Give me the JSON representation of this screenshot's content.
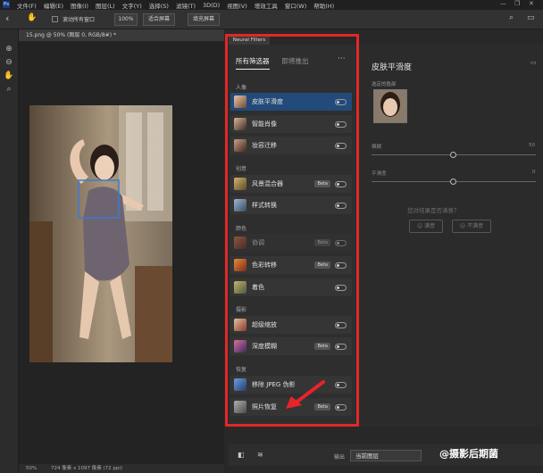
{
  "menubar": {
    "logo": "Ps",
    "items": [
      "文件(F)",
      "编辑(E)",
      "图像(I)",
      "图层(L)",
      "文字(Y)",
      "选择(S)",
      "滤镜(T)",
      "3D(D)",
      "视图(V)",
      "增效工具",
      "窗口(W)",
      "帮助(H)"
    ]
  },
  "optionsbar": {
    "scroll_all_label": "滚动所有窗口",
    "zoom_value": "100%",
    "fit_screen_label": "适合屏幕",
    "fill_screen_label": "填充屏幕"
  },
  "document": {
    "tab_title": "15.png @ 50% (图层 0, RGB/8#) *",
    "status_zoom": "50%",
    "status_info": "724 像素 x 1097 像素 (72 ppi)"
  },
  "neural_filters": {
    "panel_tab": "Neural Filters",
    "tabs": [
      "所有筛选器",
      "即将推出"
    ],
    "more_label": "···",
    "categories": [
      {
        "name": "人像",
        "filters": [
          {
            "name": "皮肤平滑度",
            "beta": ""
          },
          {
            "name": "智能肖像",
            "beta": ""
          },
          {
            "name": "妆容迁移",
            "beta": ""
          }
        ]
      },
      {
        "name": "创意",
        "filters": [
          {
            "name": "风景混合器",
            "beta": "Beta"
          },
          {
            "name": "样式转换",
            "beta": ""
          }
        ]
      },
      {
        "name": "颜色",
        "filters": [
          {
            "name": "协调",
            "beta": "Beta"
          },
          {
            "name": "色彩转移",
            "beta": "Beta"
          },
          {
            "name": "着色",
            "beta": ""
          }
        ]
      },
      {
        "name": "摄影",
        "filters": [
          {
            "name": "超级缩放",
            "beta": ""
          },
          {
            "name": "深度模糊",
            "beta": "Beta"
          }
        ]
      },
      {
        "name": "恢复",
        "filters": [
          {
            "name": "移除 JPEG 伪影",
            "beta": ""
          },
          {
            "name": "照片恢复",
            "beta": "Beta"
          }
        ]
      }
    ]
  },
  "details": {
    "title": "皮肤平滑度",
    "selected_face_label": "选定的脸部",
    "blur_label": "模糊",
    "blur_value": "50",
    "smoothness_label": "平滑度",
    "smoothness_value": "0",
    "feedback_question": "您对结果是否满意？",
    "yes_label": "满意",
    "no_label": "不满意"
  },
  "bottombar": {
    "output_label": "输出",
    "output_value": "当前图层"
  },
  "watermark": "@摄影后期菌",
  "colors": {
    "selected_row": "#224a7a",
    "highlight_frame": "#e12828",
    "annotation_arrow": "#e8232a"
  }
}
